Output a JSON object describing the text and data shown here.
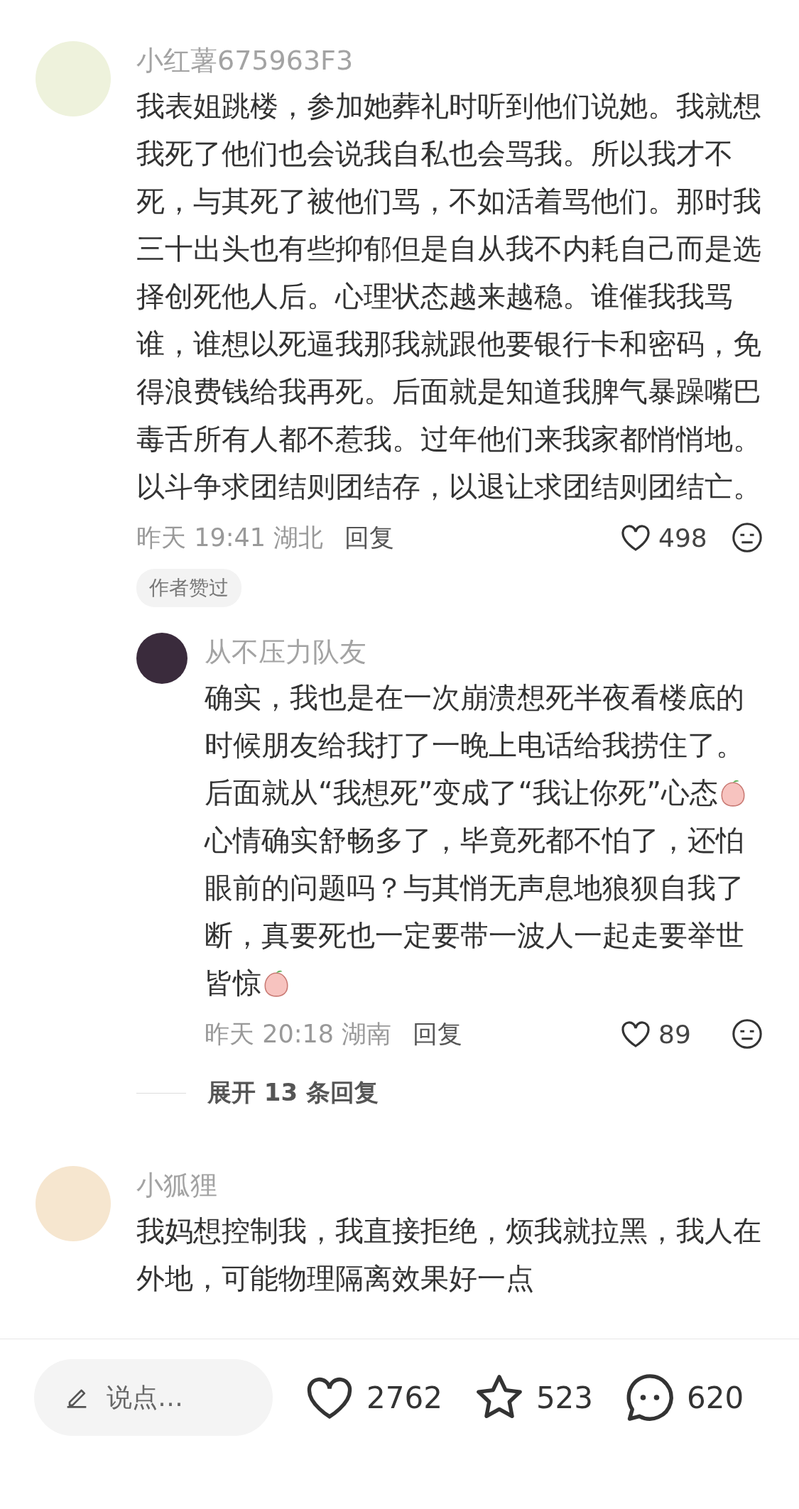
{
  "comments": [
    {
      "avatar": {
        "color": "#eef2dc"
      },
      "author": "小红薯675963F3",
      "segments": [
        {
          "kind": "text",
          "text": "我表姐跳楼，参加她葬礼时听到他们说她。我就想我死了他们也会说我自私也会骂我。所以我才不死，与其死了被他们骂，不如活着骂他们。那时我三十出头也有些抑郁但是自从我不内耗自己而是选择创死他人后。心理状态越来越稳。谁催我我骂谁，谁想以死逼我那我就跟他要银行卡和密码，免得浪费钱给我再死。后面就是知道我脾气暴躁嘴巴毒舌所有人都不惹我。过年他们来我家都悄悄地。以斗争求团结则团结存，以退让求团结则团结亡。"
        }
      ],
      "date": "昨天",
      "time": "19:41",
      "location": "湖北",
      "reply_label": "回复",
      "likes": "498",
      "tag": "作者赞过",
      "replies": [
        {
          "avatar": {
            "color": "#3a2b3c"
          },
          "author": "从不压力队友",
          "segments": [
            {
              "kind": "text",
              "text": "确实，我也是在一次崩溃想死半夜看楼底的时候朋友给我打了一晚上电话给我捞住了。后面就从“我想死”变成了“我让你死”心态"
            },
            {
              "kind": "sticker"
            },
            {
              "kind": "text",
              "text": "心情确实舒畅多了，毕竟死都不怕了，还怕眼前的问题吗？与其悄无声息地狼狈自我了断，真要死也一定要带一波人一起走要举世皆惊"
            },
            {
              "kind": "sticker"
            }
          ],
          "date": "昨天",
          "time": "20:18",
          "location": "湖南",
          "reply_label": "回复",
          "likes": "89"
        }
      ],
      "expand": "展开 13 条回复"
    },
    {
      "avatar": {
        "color": "#f6e6cf"
      },
      "author": "小狐狸",
      "segments": [
        {
          "kind": "text",
          "text": "我妈想控制我，我直接拒绝，烦我就拉黑，我人在外地，可能物理隔离效果好一点"
        }
      ]
    }
  ],
  "bottom_bar": {
    "placeholder": "说点…",
    "likes": "2762",
    "stars": "523",
    "comments": "620"
  }
}
